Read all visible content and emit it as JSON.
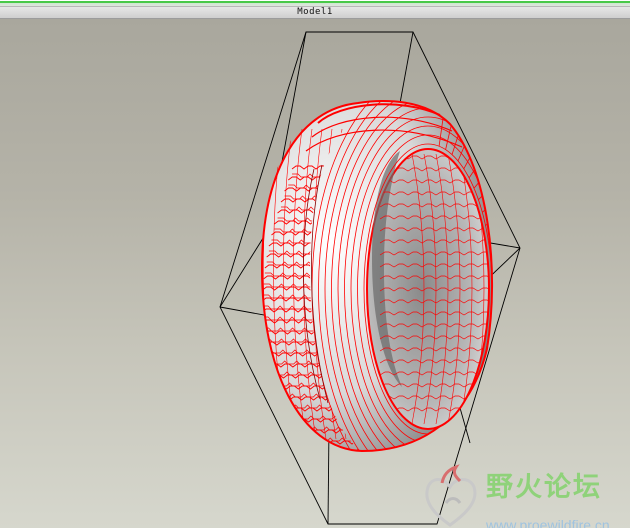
{
  "window": {
    "title": "Model1"
  },
  "colors": {
    "wireframe": "#ff0000",
    "bounding_box": "#000000",
    "title_bar": "#d9d9d9",
    "viewport_top": "#a9a79d",
    "viewport_bottom": "#d6d7cd",
    "watermark_green": "#8fd27a",
    "watermark_blue": "#9fc3e0"
  },
  "model": {
    "name": "tire",
    "display_mode": "wireframe-shaded"
  },
  "watermark": {
    "site_name_cn": "野火论坛",
    "url": "www.proewildfire.cn",
    "logo_icon": "flame-heart-logo-icon"
  }
}
